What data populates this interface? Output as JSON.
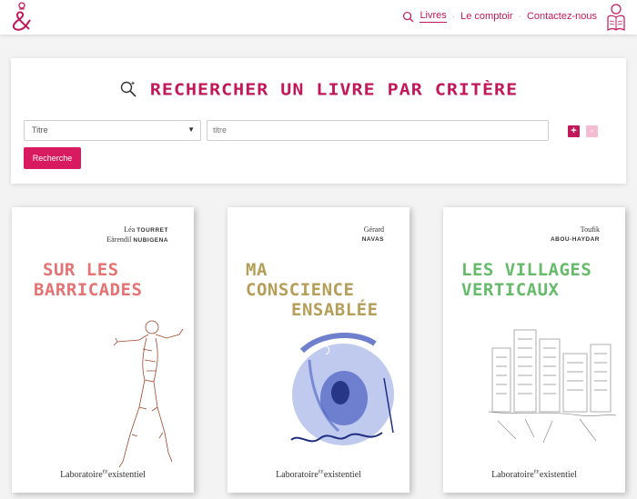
{
  "header": {
    "nav": [
      {
        "label": "Livres",
        "active": true
      },
      {
        "label": "Le comptoir",
        "active": false
      },
      {
        "label": "Contactez-nous",
        "active": false
      }
    ],
    "brand_color": "#c2185b"
  },
  "search": {
    "title": "RECHERCHER UN LIVRE PAR CRITÈRE",
    "criterion_selected": "Titre",
    "input_placeholder": "titre",
    "add_label": "+",
    "remove_label": "-",
    "submit_label": "Recherche"
  },
  "books": [
    {
      "first_names": [
        "Léa",
        "Eärendil"
      ],
      "last_names": [
        "TOURRET",
        "NUBIGENA"
      ],
      "title_lines": [
        "SUR LES",
        "BARRICADES"
      ],
      "title_color": "#e57373",
      "publisher": "Laboratoire",
      "publisher_sup": "ÉE",
      "publisher_end": "existentiel"
    },
    {
      "first_names": [
        "Gérard"
      ],
      "last_names": [
        "NAVAS"
      ],
      "title_lines": [
        "MA",
        "CONSCIENCE",
        "ENSABLÉE"
      ],
      "title_color": "#b59f58",
      "publisher": "Laboratoire",
      "publisher_sup": "ÉE",
      "publisher_end": "existentiel"
    },
    {
      "first_names": [
        "Toufik"
      ],
      "last_names": [
        "ABOU-HAYDAR"
      ],
      "title_lines": [
        "LES VILLAGES",
        "VERTICAUX"
      ],
      "title_color": "#66bb6a",
      "publisher": "Laboratoire",
      "publisher_sup": "ÉE",
      "publisher_end": "existentiel"
    }
  ]
}
